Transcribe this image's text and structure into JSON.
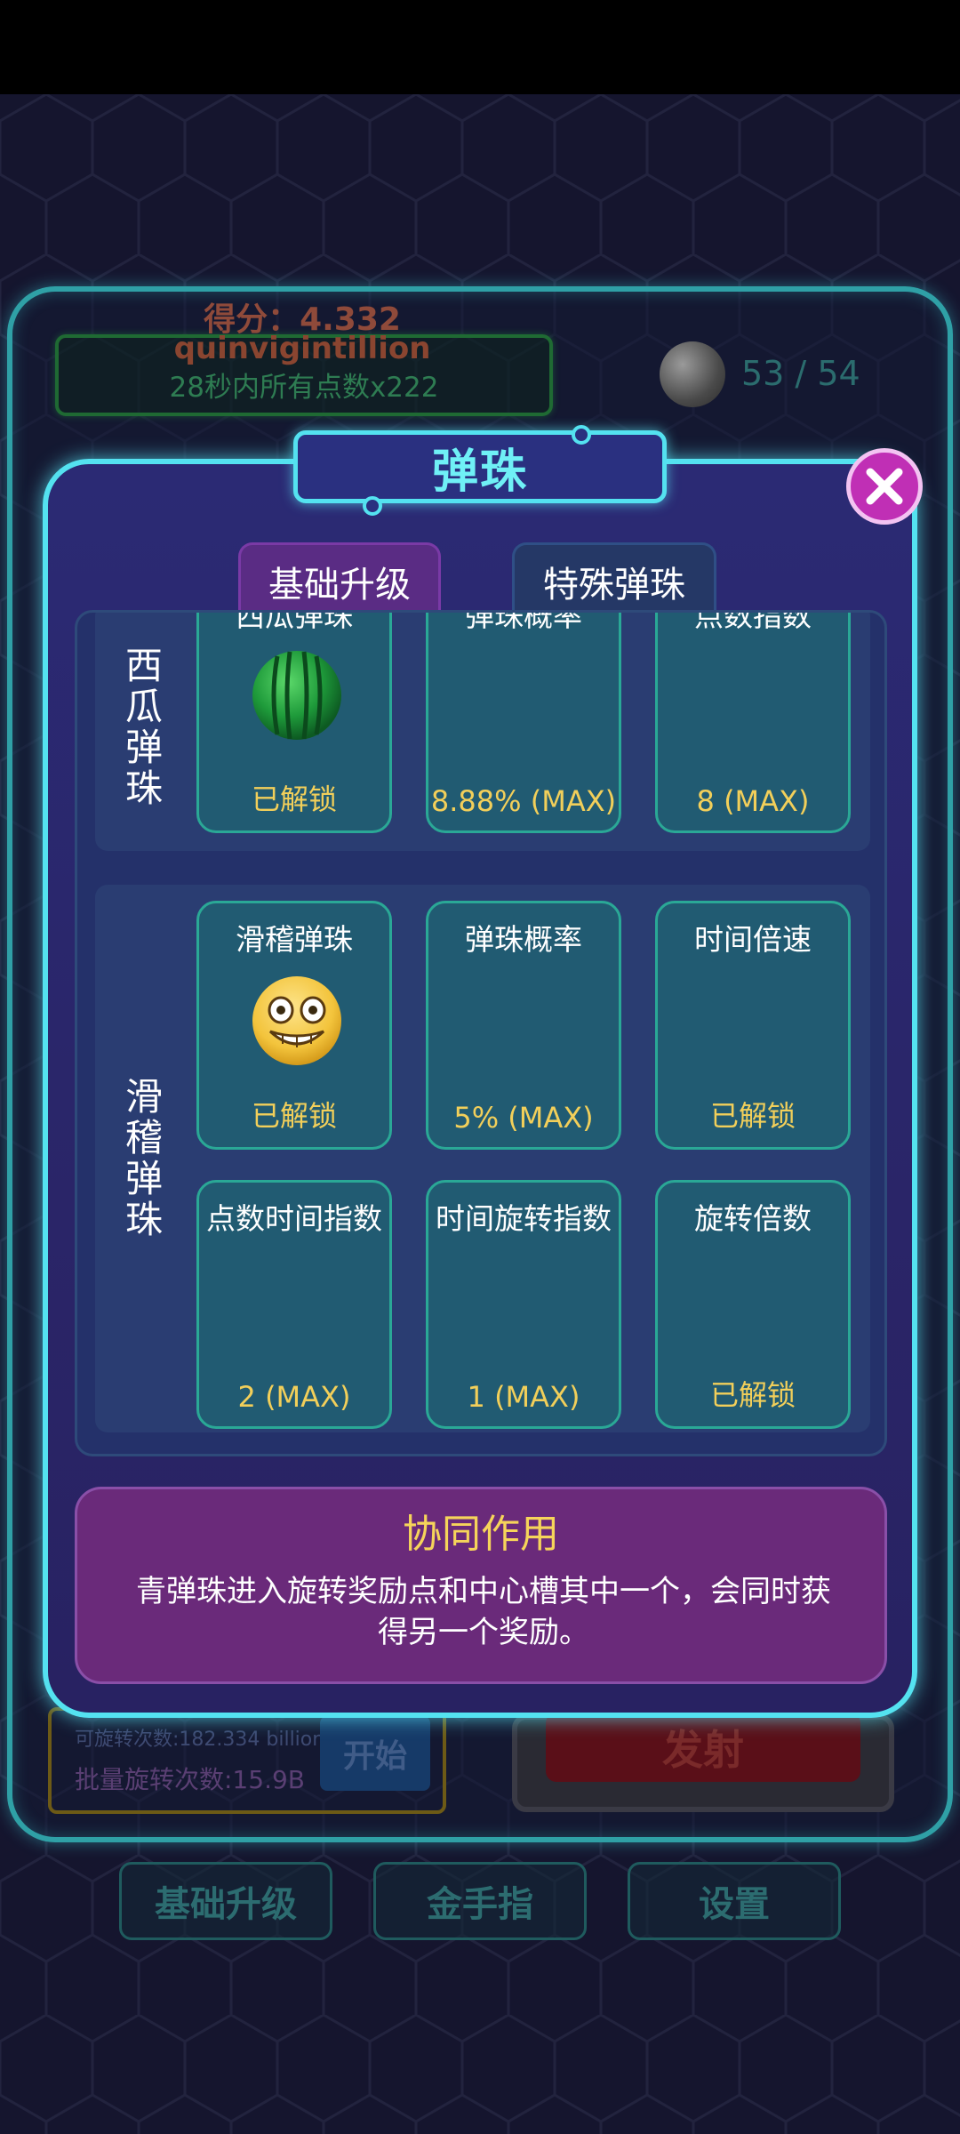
{
  "background": {
    "score_line": "得分：4.332",
    "score_unit": "quinvigintillion",
    "boost_text": "28秒内所有点数x222",
    "ball_count": "53 / 54",
    "spin_count": "可旋转次数:182.334 billion",
    "batch_count": "批量旋转次数:15.9B",
    "start_label": "开始",
    "launch_label": "发射",
    "nav": [
      "基础升级",
      "金手指",
      "设置"
    ]
  },
  "modal": {
    "title": "弹珠",
    "tabs": [
      {
        "label": "基础升级",
        "active": true
      },
      {
        "label": "特殊弹珠",
        "active": false
      }
    ],
    "groups": [
      {
        "name": "西瓜弹珠",
        "cards": [
          {
            "title": "西瓜弹珠",
            "value": "已解锁",
            "icon": "watermelon-icon"
          },
          {
            "title": "弹珠概率",
            "value": "8.88% (MAX)"
          },
          {
            "title": "点数指数",
            "value": "8 (MAX)"
          }
        ]
      },
      {
        "name": "滑稽弹珠",
        "cards": [
          {
            "title": "滑稽弹珠",
            "value": "已解锁",
            "icon": "funny-face-icon"
          },
          {
            "title": "弹珠概率",
            "value": "5% (MAX)"
          },
          {
            "title": "时间倍速",
            "value": "已解锁"
          },
          {
            "title": "点数时间指数",
            "value": "2 (MAX)"
          },
          {
            "title": "时间旋转指数",
            "value": "1 (MAX)"
          },
          {
            "title": "旋转倍数",
            "value": "已解锁"
          }
        ]
      }
    ],
    "synergy": {
      "title": "协同作用",
      "text": "青弹珠进入旋转奖励点和中心槽其中一个，会同时获得另一个奖励。"
    }
  },
  "colors": {
    "modal_border": "#54e2f0",
    "card_value": "#f2cf5a",
    "close_button": "#c02fb5"
  }
}
